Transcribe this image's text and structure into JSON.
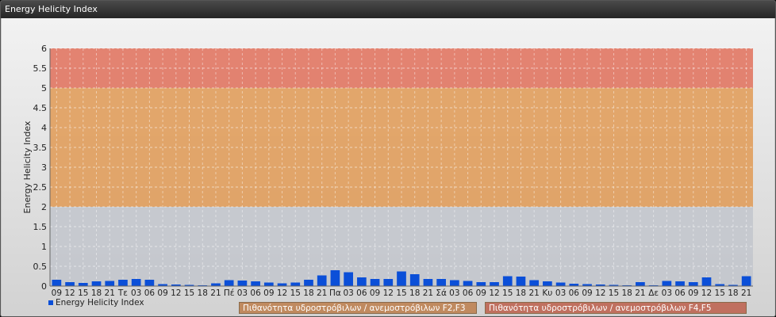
{
  "window": {
    "title": "Energy Helicity Index"
  },
  "chart_data": {
    "type": "bar",
    "title": "",
    "ylabel": "Energy Helicity Index",
    "xlabel": "",
    "ylim": [
      0,
      6
    ],
    "yticks": [
      0,
      0.5,
      1,
      1.5,
      2,
      2.5,
      3,
      3.5,
      4,
      4.5,
      5,
      5.5,
      6
    ],
    "categories": [
      "09",
      "12",
      "15",
      "18",
      "21",
      "Τε",
      "03",
      "06",
      "09",
      "12",
      "15",
      "18",
      "21",
      "Πέ",
      "03",
      "06",
      "09",
      "12",
      "15",
      "18",
      "21",
      "Πα",
      "03",
      "06",
      "09",
      "12",
      "15",
      "18",
      "21",
      "Σά",
      "03",
      "06",
      "09",
      "12",
      "15",
      "18",
      "21",
      "Κυ",
      "03",
      "06",
      "09",
      "12",
      "15",
      "18",
      "21",
      "Δε",
      "03",
      "06",
      "09",
      "12",
      "15",
      "18",
      "21"
    ],
    "series": [
      {
        "name": "Energy Helicity Index",
        "color": "#0b4fd8",
        "values": [
          0.16,
          0.1,
          0.08,
          0.12,
          0.13,
          0.16,
          0.18,
          0.16,
          0.05,
          0.04,
          0.03,
          0.02,
          0.07,
          0.15,
          0.14,
          0.12,
          0.09,
          0.07,
          0.09,
          0.16,
          0.27,
          0.4,
          0.35,
          0.22,
          0.18,
          0.18,
          0.37,
          0.3,
          0.18,
          0.18,
          0.15,
          0.13,
          0.1,
          0.1,
          0.25,
          0.24,
          0.15,
          0.12,
          0.09,
          0.06,
          0.05,
          0.04,
          0.03,
          0.02,
          0.1,
          0.02,
          0.13,
          0.12,
          0.1,
          0.22,
          0.05,
          0.03,
          0.25
        ]
      }
    ],
    "bands": [
      {
        "from": 2,
        "to": 5,
        "label": "Πιθανότητα υδροστρόβιλων / ανεμοστρόβιλων F2,F3",
        "color": "#e09a55"
      },
      {
        "from": 5,
        "to": 6,
        "label": "Πιθανότητα υδροστρόβιλων / ανεμοστρόβιλων F4,F5",
        "color": "#e0705a"
      }
    ],
    "grid": true,
    "legend": "bottom-left"
  }
}
